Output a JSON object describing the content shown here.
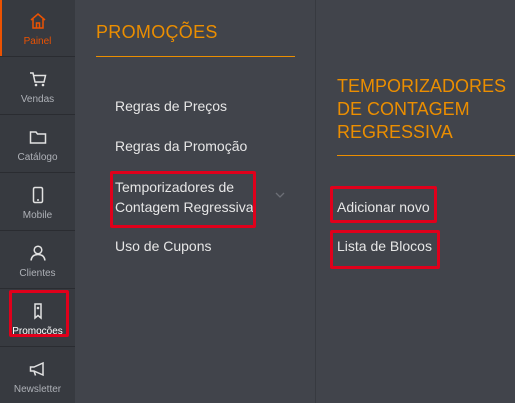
{
  "sidebar": {
    "items": [
      {
        "label": "Painel",
        "icon": "home-icon"
      },
      {
        "label": "Vendas",
        "icon": "cart-icon"
      },
      {
        "label": "Catálogo",
        "icon": "folder-icon"
      },
      {
        "label": "Mobile",
        "icon": "mobile-icon"
      },
      {
        "label": "Clientes",
        "icon": "user-icon"
      },
      {
        "label": "Promoções",
        "icon": "tag-icon"
      },
      {
        "label": "Newsletter",
        "icon": "megaphone-icon"
      }
    ]
  },
  "panel": {
    "title": "PROMOÇÕES",
    "items": [
      {
        "label": "Regras de Preços"
      },
      {
        "label": "Regras da Promoção"
      },
      {
        "label_line1": "Temporizadores de",
        "label_line2": "Contagem Regressiva"
      },
      {
        "label": "Uso de Cupons"
      }
    ]
  },
  "submenu": {
    "title_line1": "TEMPORIZADORES",
    "title_line2": "DE CONTAGEM",
    "title_line3": "REGRESSIVA",
    "items": [
      {
        "label": "Adicionar novo"
      },
      {
        "label": "Lista de Blocos"
      }
    ]
  },
  "colors": {
    "accent": "#eb8e00",
    "active_icon": "#eb5202",
    "highlight": "#e0001b",
    "sidebar_bg": "#373a40",
    "panel_bg": "#41444b"
  }
}
